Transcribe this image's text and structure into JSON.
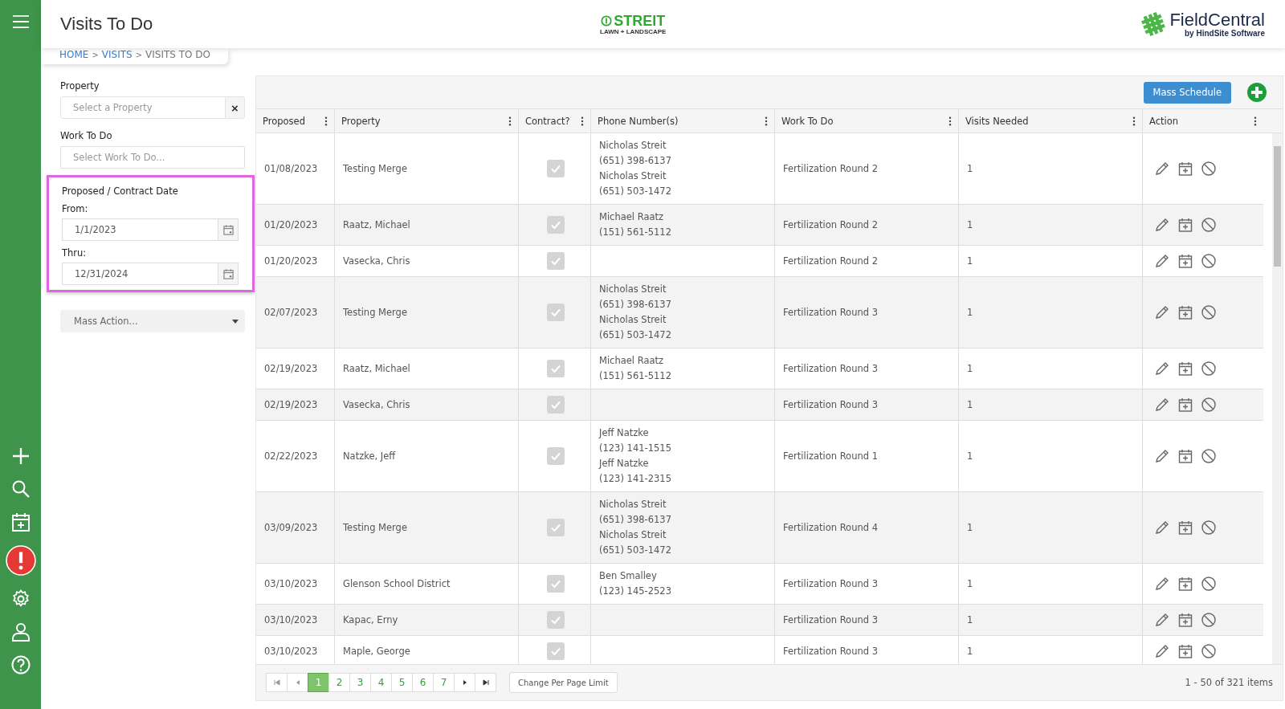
{
  "page": {
    "title": "Visits To Do"
  },
  "breadcrumb": [
    {
      "label": "HOME",
      "link": true
    },
    {
      "separator": ">",
      "label": "VISITS",
      "link": true
    },
    {
      "separator": ">",
      "label": "VISITS TO DO",
      "link": false
    }
  ],
  "brand": {
    "company": "STREIT",
    "company_sub": "LAWN + LANDSCAPE",
    "product": "FieldCentral",
    "product_sub": "by HindSite Software"
  },
  "sidebar": {
    "items": [
      {
        "kind": "add"
      },
      {
        "kind": "search"
      },
      {
        "kind": "calendar"
      },
      {
        "kind": "alert"
      },
      {
        "kind": "settings"
      },
      {
        "kind": "user"
      },
      {
        "kind": "help"
      }
    ]
  },
  "filters": {
    "property": {
      "label": "Property",
      "placeholder": "Select a Property",
      "clear": "×"
    },
    "work": {
      "label": "Work To Do",
      "placeholder": "Select Work To Do..."
    },
    "date": {
      "label": "Proposed / Contract Date",
      "highlighted": true,
      "from_label": "From:",
      "from": "1/1/2023",
      "thru_label": "Thru:",
      "thru": "12/31/2024"
    },
    "mass_action": {
      "placeholder": "Mass Action..."
    }
  },
  "toolbar": {
    "mass_schedule": "Mass Schedule"
  },
  "table": {
    "columns": [
      "Proposed",
      "Property",
      "Contract?",
      "Phone Number(s)",
      "Work To Do",
      "Visits Needed",
      "Action"
    ],
    "rows": [
      {
        "proposed": "01/08/2023",
        "property": "Testing Merge",
        "contract": true,
        "phones": [
          "Nicholas Streit",
          "(651) 398-6137",
          "Nicholas Streit",
          "(651) 503-1472"
        ],
        "work": "Fertilization Round 2",
        "visits": "1"
      },
      {
        "proposed": "01/20/2023",
        "property": "Raatz, Michael",
        "contract": true,
        "phones": [
          "Michael Raatz",
          "(151) 561-5112"
        ],
        "work": "Fertilization Round 2",
        "visits": "1"
      },
      {
        "proposed": "01/20/2023",
        "property": "Vasecka, Chris",
        "contract": true,
        "phones": [],
        "work": "Fertilization Round 2",
        "visits": "1"
      },
      {
        "proposed": "02/07/2023",
        "property": "Testing Merge",
        "contract": true,
        "phones": [
          "Nicholas Streit",
          "(651) 398-6137",
          "Nicholas Streit",
          "(651) 503-1472"
        ],
        "work": "Fertilization Round 3",
        "visits": "1"
      },
      {
        "proposed": "02/19/2023",
        "property": "Raatz, Michael",
        "contract": true,
        "phones": [
          "Michael Raatz",
          "(151) 561-5112"
        ],
        "work": "Fertilization Round 3",
        "visits": "1"
      },
      {
        "proposed": "02/19/2023",
        "property": "Vasecka, Chris",
        "contract": true,
        "phones": [],
        "work": "Fertilization Round 3",
        "visits": "1"
      },
      {
        "proposed": "02/22/2023",
        "property": "Natzke, Jeff",
        "contract": true,
        "phones": [
          "Jeff Natzke",
          "(123) 141-1515",
          "Jeff Natzke",
          "(123) 141-2315"
        ],
        "work": "Fertilization Round 1",
        "visits": "1"
      },
      {
        "proposed": "03/09/2023",
        "property": "Testing Merge",
        "contract": true,
        "phones": [
          "Nicholas Streit",
          "(651) 398-6137",
          "Nicholas Streit",
          "(651) 503-1472"
        ],
        "work": "Fertilization Round 4",
        "visits": "1"
      },
      {
        "proposed": "03/10/2023",
        "property": "Glenson School District",
        "contract": true,
        "phones": [
          "Ben Smalley",
          "(123) 145-2523"
        ],
        "work": "Fertilization Round 3",
        "visits": "1"
      },
      {
        "proposed": "03/10/2023",
        "property": "Kapac, Erny",
        "contract": true,
        "phones": [],
        "work": "Fertilization Round 3",
        "visits": "1"
      },
      {
        "proposed": "03/10/2023",
        "property": "Maple, George",
        "contract": true,
        "phones": [],
        "work": "Fertilization Round 3",
        "visits": "1"
      }
    ]
  },
  "pager": {
    "pages": [
      {
        "label": "1",
        "selected": true
      },
      {
        "label": "2",
        "selected": false
      },
      {
        "label": "3",
        "selected": false
      },
      {
        "label": "4",
        "selected": false
      },
      {
        "label": "5",
        "selected": false
      },
      {
        "label": "6",
        "selected": false
      },
      {
        "label": "7",
        "selected": false
      }
    ],
    "per_page": "Change Per Page Limit",
    "summary": "1 - 50 of 321 items"
  }
}
